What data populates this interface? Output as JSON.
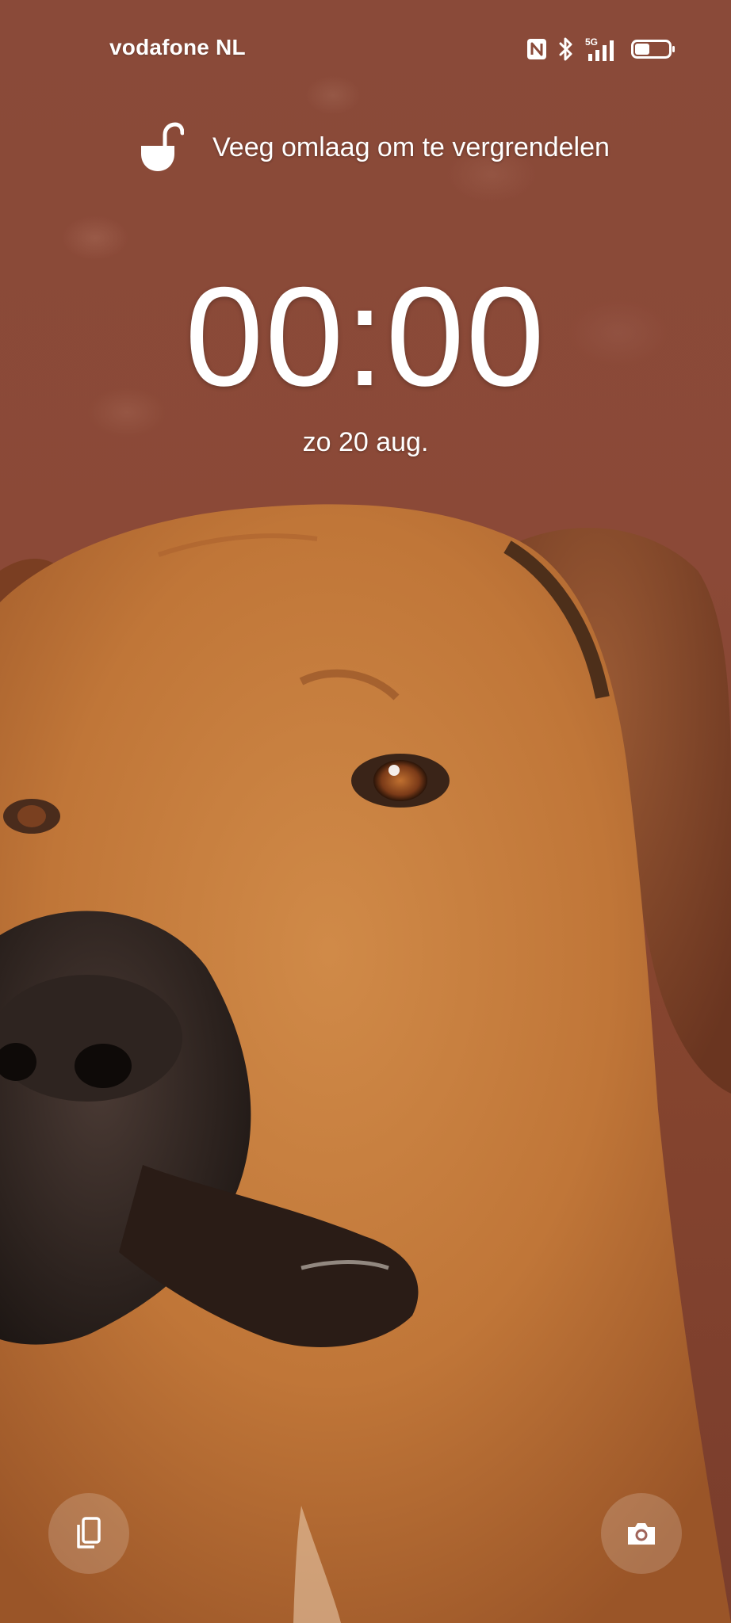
{
  "status_bar": {
    "carrier": "vodafone NL",
    "icons": [
      "nfc-icon",
      "bluetooth-icon",
      "5g-signal-icon",
      "battery-icon"
    ],
    "network_label": "5G",
    "battery_level": 0.45
  },
  "lockscreen": {
    "unlock_hint": "Veeg omlaag om te vergrendelen",
    "time": "00:00",
    "date": "zo 20 aug."
  },
  "shortcuts": {
    "left_icon": "wallet-cards-icon",
    "right_icon": "camera-icon"
  },
  "wallpaper": {
    "subject": "dog-portrait",
    "colors": {
      "background": "#8a4a39",
      "fur": "#c27a3c",
      "fur_dark": "#9a5a2a",
      "muzzle": "#2a201c"
    }
  }
}
